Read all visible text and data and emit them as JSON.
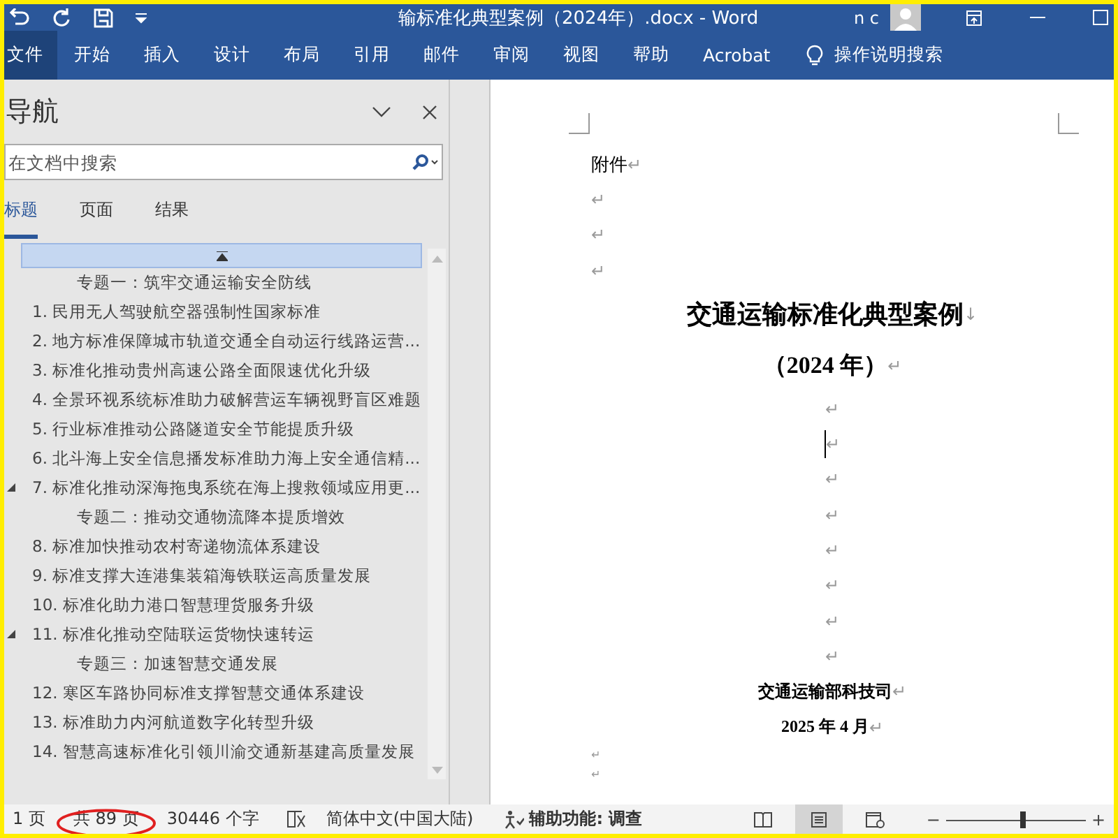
{
  "window": {
    "title": "输标准化典型案例（2024年）.docx  -  Word",
    "user": "n c"
  },
  "ribbon_tabs": [
    {
      "label": "文件",
      "selected": true
    },
    {
      "label": "开始",
      "selected": false
    },
    {
      "label": "插入",
      "selected": false
    },
    {
      "label": "设计",
      "selected": false
    },
    {
      "label": "布局",
      "selected": false
    },
    {
      "label": "引用",
      "selected": false
    },
    {
      "label": "邮件",
      "selected": false
    },
    {
      "label": "审阅",
      "selected": false
    },
    {
      "label": "视图",
      "selected": false
    },
    {
      "label": "帮助",
      "selected": false
    },
    {
      "label": "Acrobat",
      "selected": false
    }
  ],
  "tell_me": "操作说明搜索",
  "navigation": {
    "title": "导航",
    "search": {
      "placeholder": "在文档中搜索"
    },
    "tabs": [
      {
        "label": "标题",
        "selected": true
      },
      {
        "label": "页面",
        "selected": false
      },
      {
        "label": "结果",
        "selected": false
      }
    ],
    "headings": [
      {
        "text": "专题一：筑牢交通运输安全防线",
        "kind": "topic",
        "expanded": false
      },
      {
        "text": "1. 民用无人驾驶航空器强制性国家标准",
        "kind": "item",
        "expanded": false
      },
      {
        "text": "2. 地方标准保障城市轨道交通全自动运行线路运营...",
        "kind": "item",
        "expanded": false
      },
      {
        "text": "3. 标准化推动贵州高速公路全面限速优化升级",
        "kind": "item",
        "expanded": false
      },
      {
        "text": "4. 全景环视系统标准助力破解营运车辆视野盲区难题",
        "kind": "item",
        "expanded": false
      },
      {
        "text": "5. 行业标准推动公路隧道安全节能提质升级",
        "kind": "item",
        "expanded": false
      },
      {
        "text": "6. 北斗海上安全信息播发标准助力海上安全通信精...",
        "kind": "item",
        "expanded": false
      },
      {
        "text": "7. 标准化推动深海拖曳系统在海上搜救领域应用更...",
        "kind": "item",
        "expanded": true
      },
      {
        "text": "专题二：推动交通物流降本提质增效",
        "kind": "topic",
        "expanded": false
      },
      {
        "text": "8. 标准加快推动农村寄递物流体系建设",
        "kind": "item",
        "expanded": false
      },
      {
        "text": "9. 标准支撑大连港集装箱海铁联运高质量发展",
        "kind": "item",
        "expanded": false
      },
      {
        "text": "10. 标准化助力港口智慧理货服务升级",
        "kind": "item",
        "expanded": false
      },
      {
        "text": "11. 标准化推动空陆联运货物快速转运",
        "kind": "item",
        "expanded": true
      },
      {
        "text": "专题三：加速智慧交通发展",
        "kind": "topic",
        "expanded": false
      },
      {
        "text": "12. 寒区车路协同标准支撑智慧交通体系建设",
        "kind": "item",
        "expanded": false
      },
      {
        "text": "13. 标准助力内河航道数字化转型升级",
        "kind": "item",
        "expanded": false
      },
      {
        "text": "14. 智慧高速标准化引领川渝交通新基建高质量发展",
        "kind": "item",
        "expanded": false
      }
    ]
  },
  "document": {
    "paragraphs": [
      {
        "text": "附件",
        "mark": "↵",
        "kind": "normal",
        "cursor": false
      },
      {
        "mark": "↵",
        "kind": "normal",
        "cursor": false
      },
      {
        "mark": "↵",
        "kind": "normal",
        "cursor": false
      },
      {
        "mark": "↵",
        "kind": "normal",
        "cursor": false
      },
      {
        "text": "交通运输标准化典型案例",
        "mark": "↓",
        "kind": "title",
        "cursor": false
      },
      {
        "text": "（2024 年）",
        "mark": "↵",
        "kind": "subtitle",
        "cursor": false
      },
      {
        "mark": "↵",
        "kind": "center",
        "cursor": false
      },
      {
        "mark": "↵",
        "kind": "center",
        "cursor": true
      },
      {
        "mark": "↵",
        "kind": "center",
        "cursor": false
      },
      {
        "mark": "↵",
        "kind": "center",
        "cursor": false
      },
      {
        "mark": "↵",
        "kind": "center",
        "cursor": false
      },
      {
        "mark": "↵",
        "kind": "center",
        "cursor": false
      },
      {
        "mark": "↵",
        "kind": "center",
        "cursor": false
      },
      {
        "mark": "↵",
        "kind": "center",
        "cursor": false
      },
      {
        "text": "交通运输部科技司",
        "mark": "↵",
        "kind": "sign",
        "cursor": false
      },
      {
        "text": "2025 年 4 月",
        "mark": "↵",
        "kind": "sign",
        "cursor": false
      },
      {
        "mark": "↵",
        "kind": "small",
        "cursor": false
      },
      {
        "mark": "↵",
        "kind": "small",
        "cursor": false
      }
    ]
  },
  "status_bar": {
    "page": "1 页",
    "total_pages": "共 89 页",
    "word_count": "30446 个字",
    "language": "简体中文(中国大陆)",
    "accessibility": "辅助功能: 调查",
    "zoom": {
      "minus": "−",
      "level": 0.55,
      "plus": "+"
    }
  }
}
